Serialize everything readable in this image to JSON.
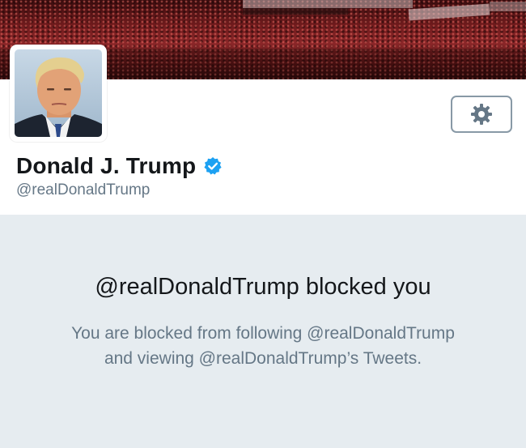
{
  "profile": {
    "name": "Donald J. Trump",
    "handle": "@realDonaldTrump",
    "verified": true,
    "avatar_icon": "profile-photo",
    "banner_icon": "crowd-photo"
  },
  "settings_button": {
    "icon": "gear-icon"
  },
  "blocked": {
    "title": "@realDonaldTrump blocked you",
    "line1": "You are blocked from following @realDonaldTrump",
    "line2": "and viewing @realDonaldTrump’s Tweets."
  },
  "colors": {
    "verified_blue": "#1da1f2",
    "name_text": "#14171a",
    "secondary_text": "#657786",
    "blocked_background": "#e6ecf0",
    "button_border": "#8899a6"
  }
}
